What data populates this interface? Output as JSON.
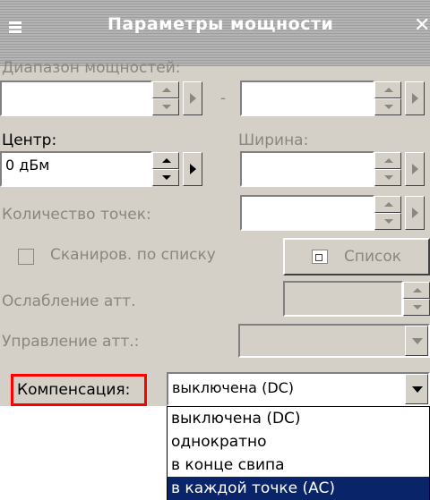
{
  "window": {
    "title": "Параметры мощности"
  },
  "power_range": {
    "label": "Диапазон мощностей:",
    "separator": "-",
    "from_value": "",
    "to_value": ""
  },
  "center": {
    "label": "Центр:",
    "value": "0 дБм"
  },
  "width": {
    "label": "Ширина:",
    "value": ""
  },
  "points": {
    "label": "Количество точек:",
    "value": ""
  },
  "list_scan": {
    "label": "Сканиров. по списку",
    "checked": false
  },
  "list_button": {
    "label": "Список"
  },
  "attenuation": {
    "label": "Ослабление атт.",
    "value": ""
  },
  "att_control": {
    "label": "Управление атт.:",
    "value": ""
  },
  "compensation": {
    "label": "Компенсация:",
    "value": "выключена (DC)",
    "options": [
      "выключена (DC)",
      "однократно",
      "в конце свипа",
      "в каждой точке (AC)"
    ],
    "highlighted_index": 3
  },
  "colors": {
    "dialog_bg": "#d4d0c8",
    "selection": "#0a246a",
    "highlight_border": "#ff0000"
  }
}
